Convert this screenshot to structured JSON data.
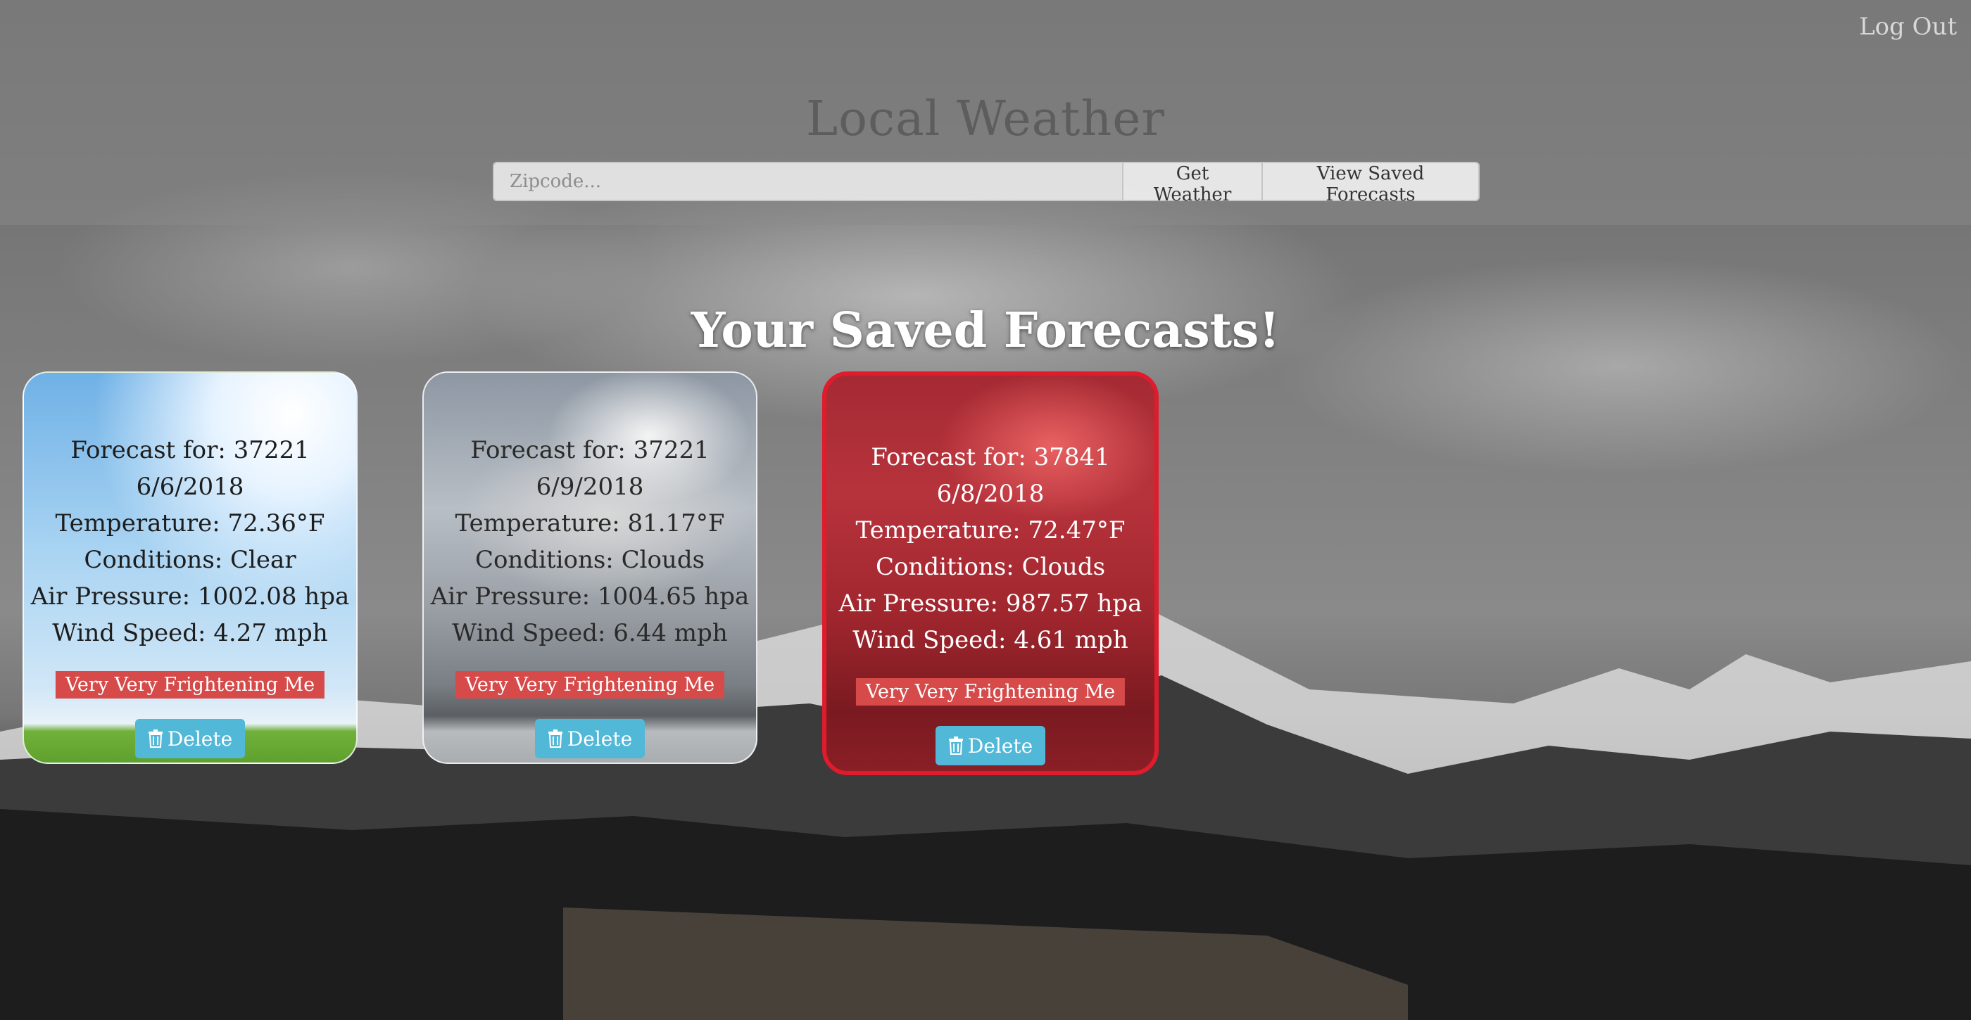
{
  "header": {
    "logout_label": "Log Out",
    "app_title": "Local Weather",
    "zip_placeholder": "Zipcode...",
    "get_weather_label": "Get Weather",
    "view_saved_label": "View Saved Forecasts"
  },
  "main": {
    "heading": "Your Saved Forecasts!",
    "cards": [
      {
        "forecast_for": "Forecast for: 37221",
        "date": "6/6/2018",
        "temperature": "Temperature: 72.36°F",
        "conditions": "Conditions: Clear",
        "air_pressure": "Air Pressure: 1002.08 hpa",
        "wind_speed": "Wind Speed: 4.27 mph",
        "alert_label": "Very Very Frightening Me",
        "delete_label": "Delete",
        "delete_icon": "trash-icon"
      },
      {
        "forecast_for": "Forecast for: 37221",
        "date": "6/9/2018",
        "temperature": "Temperature: 81.17°F",
        "conditions": "Conditions: Clouds",
        "air_pressure": "Air Pressure: 1004.65 hpa",
        "wind_speed": "Wind Speed: 6.44 mph",
        "alert_label": "Very Very Frightening Me",
        "delete_label": "Delete",
        "delete_icon": "trash-icon"
      },
      {
        "forecast_for": "Forecast for: 37841",
        "date": "6/8/2018",
        "temperature": "Temperature: 72.47°F",
        "conditions": "Conditions: Clouds",
        "air_pressure": "Air Pressure: 987.57 hpa",
        "wind_speed": "Wind Speed: 4.61 mph",
        "alert_label": "Very Very Frightening Me",
        "delete_label": "Delete",
        "delete_icon": "trash-icon"
      }
    ]
  },
  "colors": {
    "alert_badge": "#d64a4a",
    "delete_button": "#52b8d8",
    "selected_card_border": "#e01b2b"
  }
}
